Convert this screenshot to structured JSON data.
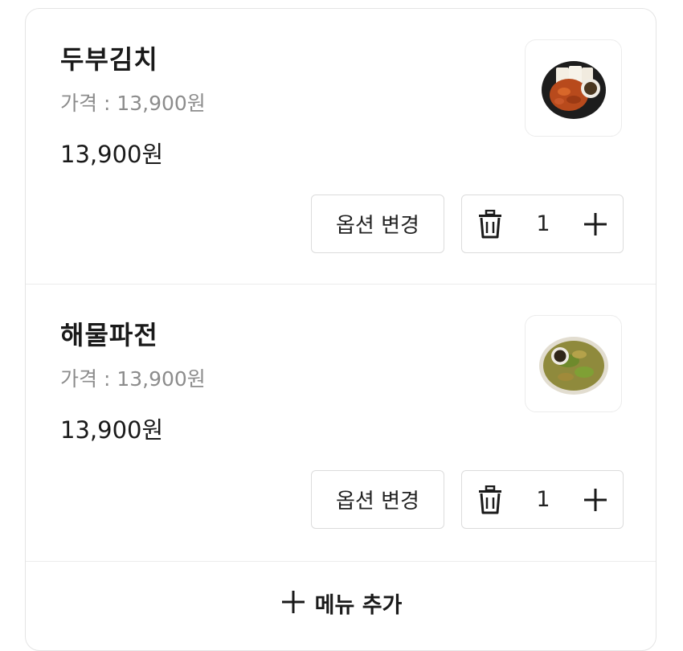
{
  "cart": {
    "items": [
      {
        "name": "두부김치",
        "price_line": "가격 : 13,900원",
        "total": "13,900원",
        "option_label": "옵션 변경",
        "quantity": "1",
        "image_icon": "tofu-kimchi-dish-icon"
      },
      {
        "name": "해물파전",
        "price_line": "가격 : 13,900원",
        "total": "13,900원",
        "option_label": "옵션 변경",
        "quantity": "1",
        "image_icon": "seafood-pancake-dish-icon"
      }
    ],
    "add_menu_label": "메뉴 추가"
  },
  "colors": {
    "text": "#1a1a1a",
    "muted": "#8c8c8c",
    "border": "#dcdcdc"
  }
}
